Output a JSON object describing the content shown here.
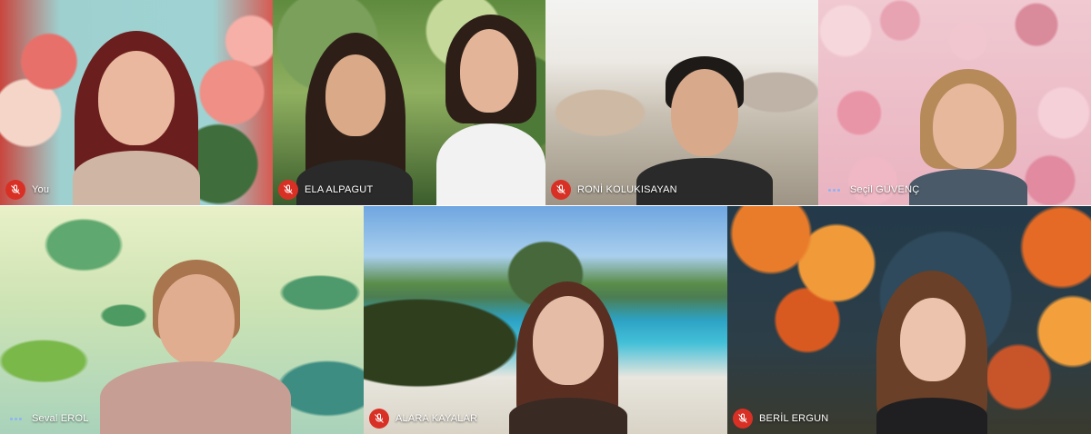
{
  "participants": [
    {
      "name": "You",
      "muted": true
    },
    {
      "name": "ELA ALPAGUT",
      "muted": true
    },
    {
      "name": "RONİ KOLUKISAYAN",
      "muted": true
    },
    {
      "name": "Seçil GÜVENÇ",
      "muted": false,
      "speaking": true
    },
    {
      "name": "Seval EROL",
      "muted": false,
      "speaking": true
    },
    {
      "name": "ALARA KAYALAR",
      "muted": true
    },
    {
      "name": "BERİL ERGUN",
      "muted": true
    }
  ],
  "icons": {
    "muted": "mic-off-icon",
    "speaking": "speaking-dots-icon"
  },
  "colors": {
    "mute_badge": "#d93025",
    "speaking_dots": "#8ab4f8"
  }
}
